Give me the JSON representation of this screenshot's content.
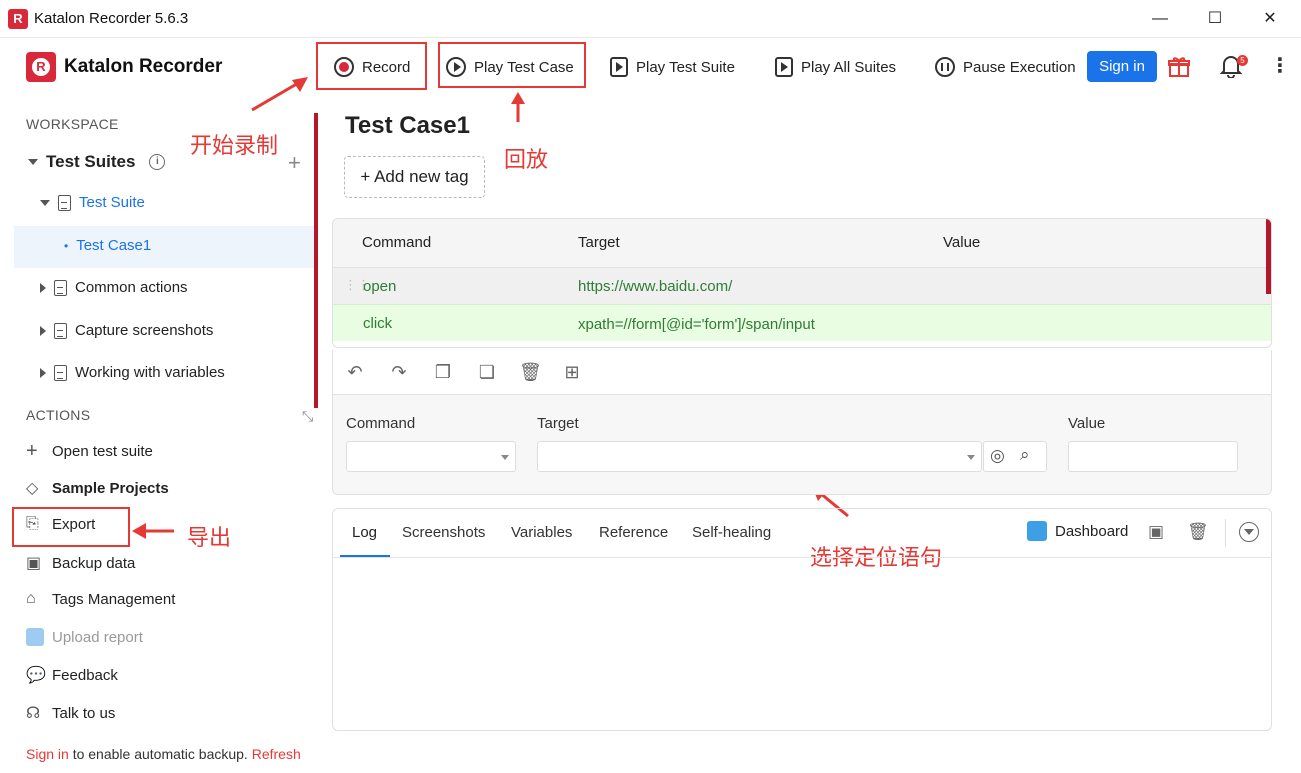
{
  "window": {
    "title": "Katalon Recorder 5.6.3",
    "minimize": "—",
    "maximize": "☐",
    "close": "✕"
  },
  "brand": {
    "name": "Katalon Recorder",
    "logo_letter": "R"
  },
  "toolbar": {
    "record": "Record",
    "play_test_case": "Play Test Case",
    "play_test_suite": "Play Test Suite",
    "play_all_suites": "Play All Suites",
    "pause_execution": "Pause Execution",
    "sign_in": "Sign in",
    "notification_count": "5"
  },
  "annotations": {
    "record": "开始录制",
    "play": "回放",
    "export": "导出",
    "locator": "选择定位语句"
  },
  "sidebar": {
    "workspace_heading": "WORKSPACE",
    "test_suites_label": "Test Suites",
    "tree": [
      {
        "label": "Test Suite",
        "expanded": true
      },
      {
        "label": "Test Case1",
        "selected": true
      },
      {
        "label": "Common actions"
      },
      {
        "label": "Capture screenshots"
      },
      {
        "label": "Working with variables"
      }
    ],
    "actions_heading": "ACTIONS",
    "actions": [
      {
        "label": "Open test suite"
      },
      {
        "label": "Sample Projects"
      },
      {
        "label": "Export"
      },
      {
        "label": "Backup data"
      },
      {
        "label": "Tags Management"
      },
      {
        "label": "Upload report"
      },
      {
        "label": "Feedback"
      },
      {
        "label": "Talk to us"
      }
    ],
    "footer": {
      "sign_in": "Sign in",
      "text": " to enable automatic backup. ",
      "refresh": "Refresh"
    }
  },
  "main": {
    "test_case_title": "Test Case1",
    "add_tag": "Add new tag",
    "table": {
      "headers": [
        "Command",
        "Target",
        "Value"
      ],
      "rows": [
        {
          "command": "open",
          "target": "https://www.baidu.com/",
          "value": ""
        },
        {
          "command": "click",
          "target": "xpath=//form[@id='form']/span/input",
          "value": ""
        }
      ]
    },
    "editor": {
      "command_label": "Command",
      "target_label": "Target",
      "value_label": "Value"
    },
    "log_tabs": [
      "Log",
      "Screenshots",
      "Variables",
      "Reference",
      "Self-healing"
    ],
    "dashboard": "Dashboard"
  },
  "colors": {
    "accent": "#1a73e8",
    "brand": "#d9283a",
    "annotation": "#e53935",
    "row_green": "#e8fde2",
    "cmd_text": "#2e7d32"
  }
}
